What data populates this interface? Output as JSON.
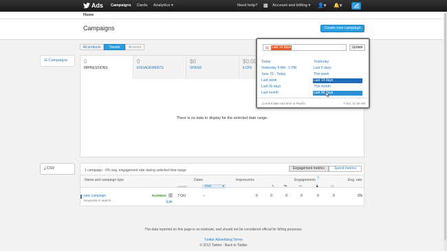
{
  "topbar": {
    "brand": "Ads",
    "nav": [
      "Campaigns",
      "Cards",
      "Analytics ▾"
    ],
    "help": "Need help?",
    "account": "Account and billing ▾"
  },
  "breadcrumb": "Home",
  "page_title": "Campaigns",
  "create_button": "Create new campaign",
  "sidebar": {
    "campaigns": "Campaigns",
    "csv": "CSV"
  },
  "filters": [
    "All products",
    "Tweets",
    "Account"
  ],
  "stats": [
    {
      "value": "0",
      "label": "IMPRESSIONS"
    },
    {
      "value": "0",
      "label": "ENGAGEMENTS"
    },
    {
      "value": "$0",
      "label": "SPEND"
    },
    {
      "value": "$0.00",
      "label": "ECPE"
    }
  ],
  "no_data": "There is no data to display for the selected date range.",
  "daterange": {
    "input_value": "Last 14 days",
    "update_label": "Update",
    "left_options": [
      "Today",
      "Yesterday 9 AM - 5 PM",
      "June 15 - Today",
      "Last week",
      "Last 30 days",
      "Last month"
    ],
    "right_options": [
      "Yesterday",
      "Last 5 days",
      "This week",
      "Last 14 days",
      "This month",
      "Last 90 days"
    ],
    "footer_left": "Current date and time in Pacific:",
    "footer_right": "7 Oct, 11:40 AM"
  },
  "table": {
    "summary": "1 campaign - 0% avg. engagement rate during selected time range",
    "seg_left": "Engagement metrics",
    "seg_right": "Spend metrics",
    "headers": {
      "name": "Name and campaign type",
      "dates": "Dates",
      "impressions": "Impressions",
      "engagements": "Engagements",
      "eng_rate": "Eng. rate",
      "start": "START",
      "end": "END"
    },
    "row": {
      "name": "new campaign",
      "type": "Keywords in search",
      "status": "RUNNING",
      "edit": "Edit",
      "start": "7 Oct",
      "end": "--",
      "impressions": "0",
      "e1": "0",
      "e2": "0",
      "e3": "0",
      "e4": "0",
      "e5": "0",
      "rate": "0%"
    }
  },
  "footer": {
    "disclaimer": "The data reported on this page is an estimate, and should not be considered official for billing purposes.",
    "terms": "Twitter Advertising Terms",
    "copyright": "© 2013 Twitter · Back to Twitter"
  }
}
